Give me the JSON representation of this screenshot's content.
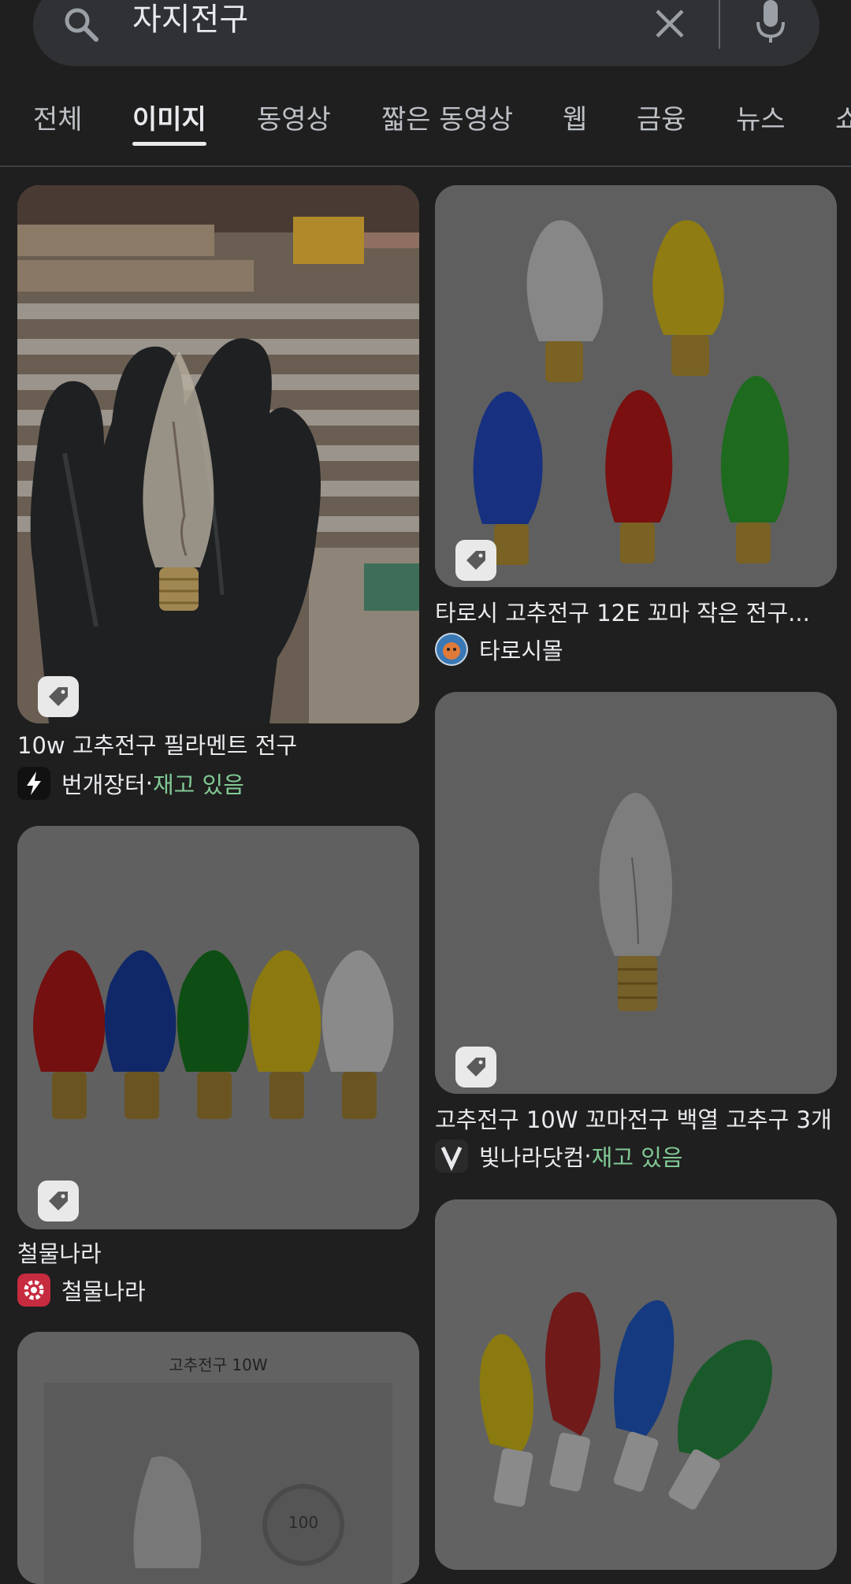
{
  "search": {
    "query": "자지전구"
  },
  "tabs": [
    {
      "label": "전체"
    },
    {
      "label": "이미지"
    },
    {
      "label": "동영상"
    },
    {
      "label": "짧은 동영상"
    },
    {
      "label": "웹"
    },
    {
      "label": "금융"
    },
    {
      "label": "뉴스"
    },
    {
      "label": "쇼"
    }
  ],
  "active_tab": "이미지",
  "results": [
    {
      "title": "10w 고추전구 필라멘트 전구",
      "source": "번개장터",
      "separator": " · ",
      "stock": "재고 있음"
    },
    {
      "title": "타로시 고추전구 12E 꼬마 작은 전구...",
      "source": "타로시몰"
    },
    {
      "title": "철물나라",
      "source": "철물나라"
    },
    {
      "title": "고추전구 10W 꼬마전구 백열 고추구 3개",
      "source": "빛나라닷컴",
      "separator": " · ",
      "stock": "재고 있음"
    },
    {
      "image_text": "고추전구 10W",
      "coin_text": "100"
    }
  ],
  "icons": [
    "search-icon",
    "clear-icon",
    "mic-icon",
    "tag-icon",
    "bolt-icon",
    "v-logo-icon",
    "gear-logo-icon"
  ],
  "colors": {
    "background": "#1f1f1f",
    "searchbar": "#303134",
    "in_stock": "#81c995",
    "red_logo": "#c62b3f"
  }
}
